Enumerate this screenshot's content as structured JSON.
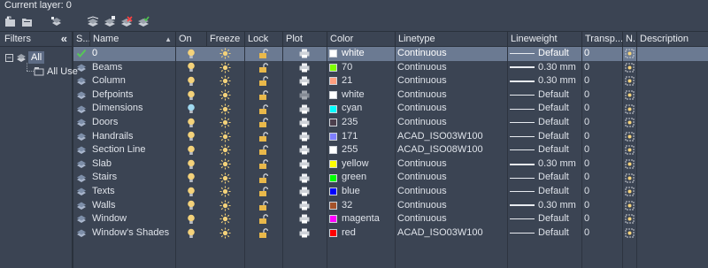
{
  "current_layer": "Current layer: 0",
  "filters": {
    "title": "Filters",
    "collapse_icon": "«",
    "tree": {
      "expander": "−",
      "all": "All",
      "all_used": "All Use"
    }
  },
  "columns": [
    "S...",
    "Name",
    "On",
    "Freeze",
    "Lock",
    "Plot",
    "Color",
    "Linetype",
    "Lineweight",
    "Transp...",
    "N...",
    "Description"
  ],
  "colors": {
    "white": "#ffffff",
    "70": "#7fff00",
    "21": "#ff9f7f",
    "cyan": "#00ffff",
    "235": "#4c3f4c",
    "171": "#7f7fff",
    "255": "#ffffff",
    "yellow": "#ffff00",
    "green": "#00ff00",
    "blue": "#0000ff",
    "32": "#a5522a",
    "magenta": "#ff00ff",
    "red": "#ff0000"
  },
  "layers": [
    {
      "status": "current",
      "name": "0",
      "on": true,
      "freeze": false,
      "lock": false,
      "plot": true,
      "color": "white",
      "swatch": "#ffffff",
      "linetype": "Continuous",
      "lineweight": "Default",
      "lw_thick": false,
      "transparency": "0"
    },
    {
      "status": "",
      "name": "Beams",
      "on": true,
      "freeze": false,
      "lock": false,
      "plot": true,
      "color": "70",
      "swatch": "#7fff00",
      "linetype": "Continuous",
      "lineweight": "0.30 mm",
      "lw_thick": true,
      "transparency": "0"
    },
    {
      "status": "",
      "name": "Column",
      "on": true,
      "freeze": false,
      "lock": false,
      "plot": true,
      "color": "21",
      "swatch": "#ff9f7f",
      "linetype": "Continuous",
      "lineweight": "0.30 mm",
      "lw_thick": true,
      "transparency": "0"
    },
    {
      "status": "",
      "name": "Defpoints",
      "on": true,
      "freeze": false,
      "lock": false,
      "plot": false,
      "color": "white",
      "swatch": "#ffffff",
      "linetype": "Continuous",
      "lineweight": "Default",
      "lw_thick": false,
      "transparency": "0"
    },
    {
      "status": "",
      "name": "Dimensions",
      "on": true,
      "freeze": false,
      "lock": false,
      "plot": true,
      "color": "cyan",
      "swatch": "#00ffff",
      "linetype": "Continuous",
      "lineweight": "Default",
      "lw_thick": false,
      "transparency": "0"
    },
    {
      "status": "",
      "name": "Doors",
      "on": true,
      "freeze": false,
      "lock": false,
      "plot": true,
      "color": "235",
      "swatch": "#4c3f4c",
      "linetype": "Continuous",
      "lineweight": "Default",
      "lw_thick": false,
      "transparency": "0"
    },
    {
      "status": "",
      "name": "Handrails",
      "on": true,
      "freeze": false,
      "lock": false,
      "plot": true,
      "color": "171",
      "swatch": "#7f7fff",
      "linetype": "ACAD_ISO03W100",
      "lineweight": "Default",
      "lw_thick": false,
      "transparency": "0"
    },
    {
      "status": "",
      "name": "Section Line",
      "on": true,
      "freeze": false,
      "lock": false,
      "plot": true,
      "color": "255",
      "swatch": "#ffffff",
      "linetype": "ACAD_ISO08W100",
      "lineweight": "Default",
      "lw_thick": false,
      "transparency": "0"
    },
    {
      "status": "",
      "name": "Slab",
      "on": true,
      "freeze": false,
      "lock": false,
      "plot": true,
      "color": "yellow",
      "swatch": "#ffff00",
      "linetype": "Continuous",
      "lineweight": "0.30 mm",
      "lw_thick": true,
      "transparency": "0"
    },
    {
      "status": "",
      "name": "Stairs",
      "on": true,
      "freeze": false,
      "lock": false,
      "plot": true,
      "color": "green",
      "swatch": "#00ff00",
      "linetype": "Continuous",
      "lineweight": "Default",
      "lw_thick": false,
      "transparency": "0"
    },
    {
      "status": "",
      "name": "Texts",
      "on": true,
      "freeze": false,
      "lock": false,
      "plot": true,
      "color": "blue",
      "swatch": "#0000ff",
      "linetype": "Continuous",
      "lineweight": "Default",
      "lw_thick": false,
      "transparency": "0"
    },
    {
      "status": "",
      "name": "Walls",
      "on": true,
      "freeze": false,
      "lock": false,
      "plot": true,
      "color": "32",
      "swatch": "#a5522a",
      "linetype": "Continuous",
      "lineweight": "0.30 mm",
      "lw_thick": true,
      "transparency": "0"
    },
    {
      "status": "",
      "name": "Window",
      "on": true,
      "freeze": false,
      "lock": false,
      "plot": true,
      "color": "magenta",
      "swatch": "#ff00ff",
      "linetype": "Continuous",
      "lineweight": "Default",
      "lw_thick": false,
      "transparency": "0"
    },
    {
      "status": "",
      "name": "Window's Shades",
      "on": true,
      "freeze": false,
      "lock": false,
      "plot": true,
      "color": "red",
      "swatch": "#ff0000",
      "linetype": "ACAD_ISO03W100",
      "lineweight": "Default",
      "lw_thick": false,
      "transparency": "0"
    }
  ],
  "icons": {
    "toolbar": [
      "new-property-filter-icon",
      "new-group-filter-icon",
      "layer-states-manager-icon",
      "new-layer-icon",
      "new-layer-vp-frozen-icon",
      "delete-layer-icon",
      "set-current-icon"
    ],
    "on": "lightbulb-icon",
    "freeze": "sun-icon",
    "lock": "unlocked-padlock-icon",
    "plot": "printer-icon",
    "new_vp_freeze": "new-vp-freeze-icon",
    "current": "checkmark-icon"
  }
}
